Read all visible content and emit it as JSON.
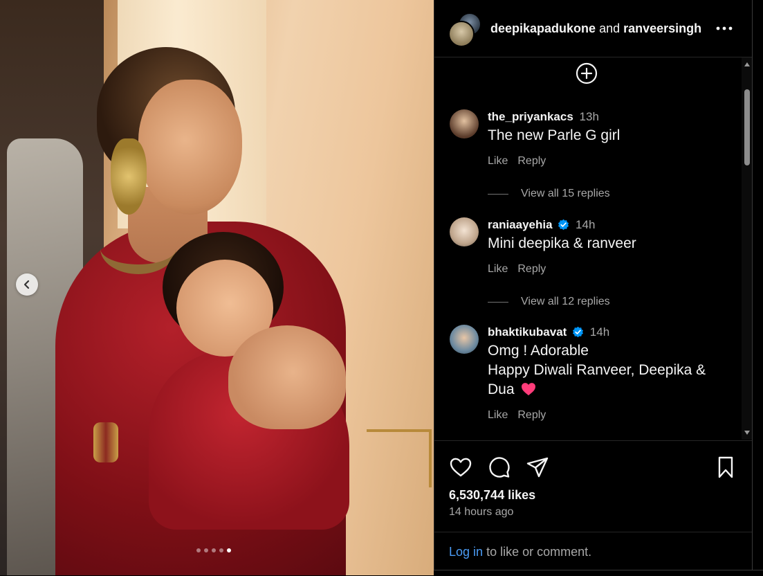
{
  "post": {
    "author1": "deepikapadukone",
    "joiner": "and",
    "author2": "ranveersingh",
    "likes": "6,530,744 likes",
    "posted": "14 hours ago",
    "carousel": {
      "count": 5,
      "active_index": 5
    }
  },
  "comments": [
    {
      "username": "the_priyankacs",
      "verified": false,
      "time": "13h",
      "text": "The new Parle G girl",
      "like": "Like",
      "reply": "Reply",
      "replies": "View all 15 replies"
    },
    {
      "username": "raniaayehia",
      "verified": true,
      "time": "14h",
      "text": "Mini deepika & ranveer",
      "like": "Like",
      "reply": "Reply",
      "replies": "View all 12 replies"
    },
    {
      "username": "bhaktikubavat",
      "verified": true,
      "time": "14h",
      "text_line1": "Omg ! Adorable",
      "text_line2": "Happy Diwali Ranveer, Deepika &",
      "text_line3": "Dua",
      "emoji": "heart-emoji",
      "like": "Like",
      "reply": "Reply"
    }
  ],
  "login": {
    "link": "Log in",
    "rest": "to like or comment."
  },
  "icons": [
    "more-icon",
    "add-comment-icon",
    "heart-icon",
    "comment-icon",
    "share-icon",
    "bookmark-icon",
    "chevron-left-icon",
    "verified-icon"
  ],
  "colors": {
    "background": "#000000",
    "link": "#4b9cf5",
    "verified": "#0095f6",
    "heart_emoji": "#ff3040",
    "secondary_text": "#a8a8a8"
  }
}
